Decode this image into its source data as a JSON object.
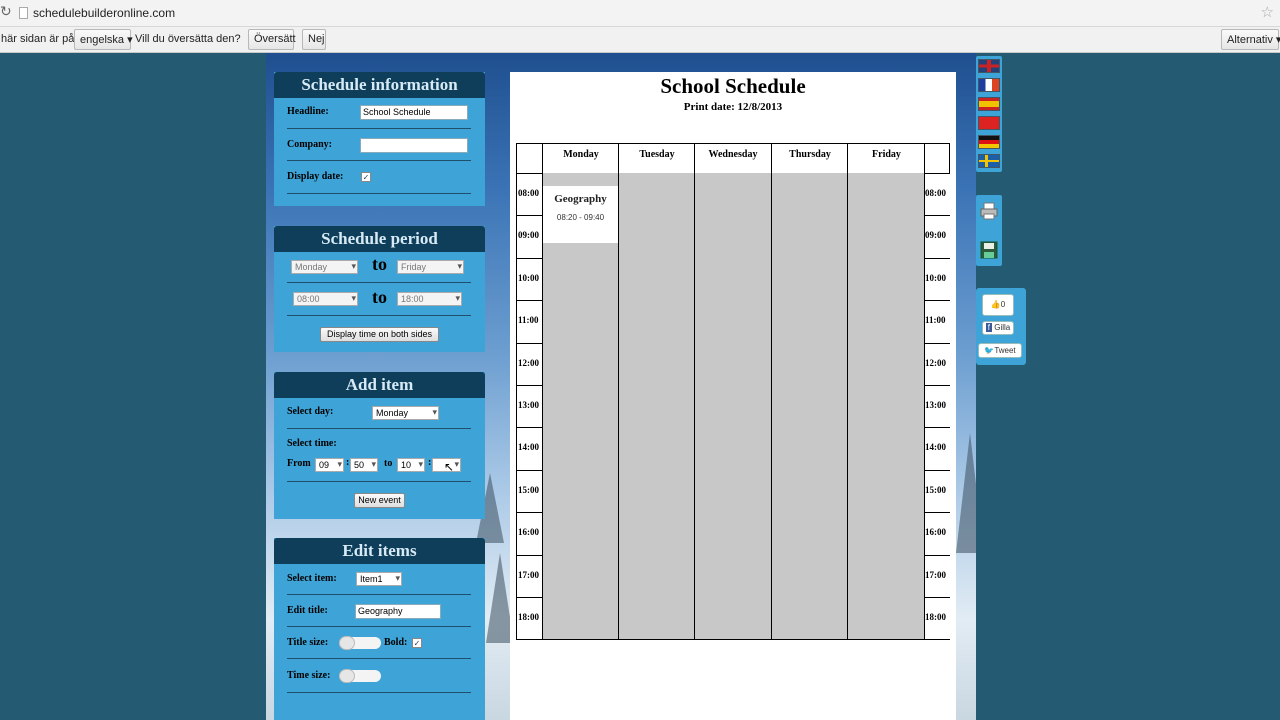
{
  "browser": {
    "url": "schedulebuilderonline.com"
  },
  "translate_bar": {
    "prefix": "här sidan är på",
    "language": "engelska",
    "question": "Vill du översätta den?",
    "translate_label": "Översätt",
    "no_label": "Nej",
    "options_label": "Alternativ"
  },
  "schedule_info": {
    "title": "Schedule information",
    "headline_label": "Headline:",
    "headline_value": "School Schedule",
    "company_label": "Company:",
    "company_value": "",
    "display_date_label": "Display date:",
    "display_date_checked": true
  },
  "schedule_period": {
    "title": "Schedule period",
    "from_day": "Monday",
    "to_word": "to",
    "to_day": "Friday",
    "from_time": "08:00",
    "to_time": "18:00",
    "display_both_sides_label": "Display time on both sides"
  },
  "add_item": {
    "title": "Add item",
    "select_day_label": "Select day:",
    "select_day_value": "Monday",
    "select_time_label": "Select time:",
    "from_label": "From",
    "from_hour": "09",
    "from_min": "50",
    "to_label": "to",
    "to_hour": "10",
    "to_min": "",
    "new_event_label": "New event"
  },
  "edit_items": {
    "title": "Edit items",
    "select_item_label": "Select item:",
    "select_item_value": "Item1",
    "edit_title_label": "Edit title:",
    "edit_title_value": "Geography",
    "title_size_label": "Title size:",
    "bold_label": "Bold:",
    "bold_checked": true,
    "time_size_label": "Time size:"
  },
  "schedule": {
    "title": "School Schedule",
    "print_date": "Print date: 12/8/2013",
    "days": [
      "Monday",
      "Tuesday",
      "Wednesday",
      "Thursday",
      "Friday"
    ],
    "times": [
      "08:00",
      "09:00",
      "10:00",
      "11:00",
      "12:00",
      "13:00",
      "14:00",
      "15:00",
      "16:00",
      "17:00",
      "18:00"
    ],
    "event": {
      "title": "Geography",
      "time": "08:20 - 09:40",
      "day": "Monday"
    }
  },
  "social": {
    "like_count": "0",
    "fb_label": "Gilla",
    "tweet_label": "Tweet"
  },
  "colors": {
    "panel": "#3ea3d6",
    "panel_header": "#0e3e5a",
    "page_bg": "#245a72",
    "grid_cell": "#c8c8c8"
  }
}
